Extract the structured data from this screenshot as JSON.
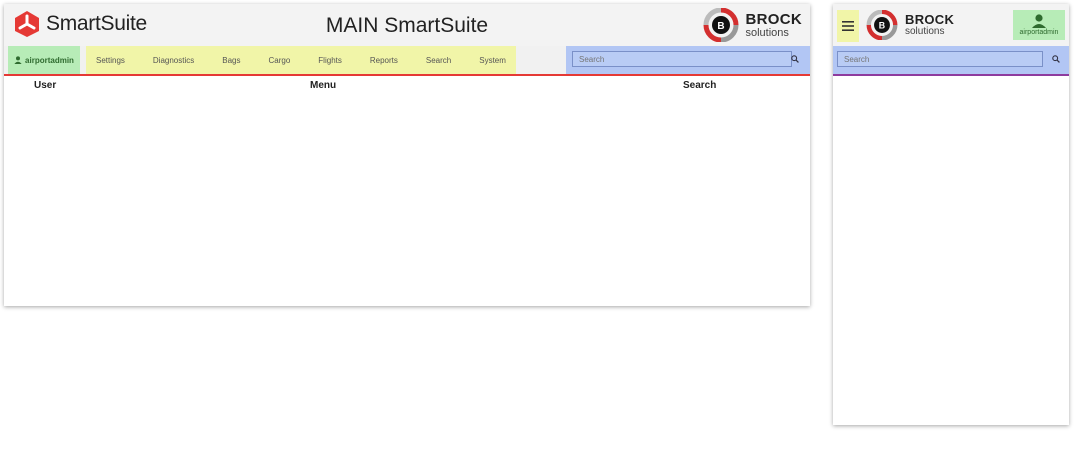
{
  "desktop": {
    "brand": "SmartSuite",
    "title": "MAIN SmartSuite",
    "company": {
      "name": "BROCK",
      "sub": "solutions",
      "badge": "B"
    },
    "user": "airportadmin",
    "menu": [
      "Settings",
      "Diagnostics",
      "Bags",
      "Cargo",
      "Flights",
      "Reports",
      "Search",
      "System"
    ],
    "search_placeholder": "Search",
    "labels": {
      "user": "User",
      "menu": "Menu",
      "search": "Search"
    }
  },
  "mobile": {
    "company": {
      "name": "BROCK",
      "sub": "solutions",
      "badge": "B"
    },
    "user": "airportadmin",
    "search_placeholder": "Search"
  },
  "colors": {
    "user_zone": "#b7ecb7",
    "menu_zone": "#f1f5a8",
    "search_zone": "#b2c6f4",
    "accent_red": "#e53935",
    "brock_red": "#d32f2f"
  },
  "icons": {
    "brand": "smartsuite-logo-icon",
    "user": "user-icon",
    "search": "search-icon",
    "menu": "hamburger-icon",
    "company": "brock-logo-icon"
  }
}
